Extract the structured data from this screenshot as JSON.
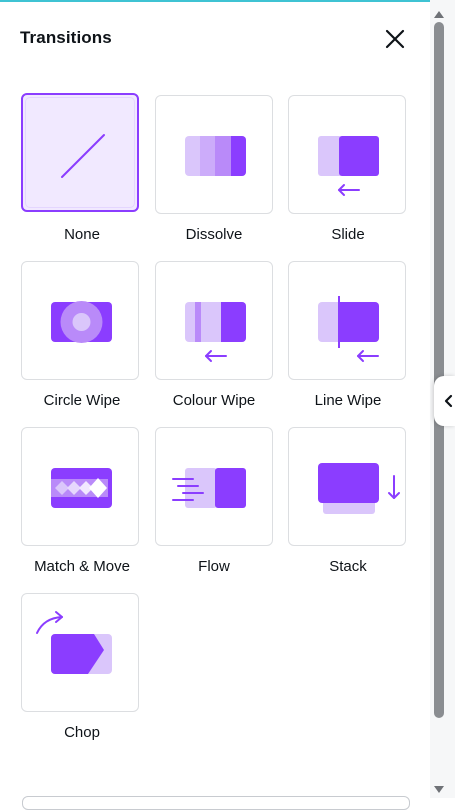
{
  "panel": {
    "title": "Transitions",
    "close_icon": "close-icon"
  },
  "transitions": [
    {
      "label": "None",
      "icon": "none-transition-icon",
      "selected": true
    },
    {
      "label": "Dissolve",
      "icon": "dissolve-transition-icon"
    },
    {
      "label": "Slide",
      "icon": "slide-transition-icon"
    },
    {
      "label": "Circle Wipe",
      "icon": "circle-wipe-transition-icon"
    },
    {
      "label": "Colour Wipe",
      "icon": "colour-wipe-transition-icon"
    },
    {
      "label": "Line Wipe",
      "icon": "line-wipe-transition-icon"
    },
    {
      "label": "Match & Move",
      "icon": "match-and-move-transition-icon"
    },
    {
      "label": "Flow",
      "icon": "flow-transition-icon"
    },
    {
      "label": "Stack",
      "icon": "stack-transition-icon"
    },
    {
      "label": "Chop",
      "icon": "chop-transition-icon"
    }
  ],
  "colors": {
    "accent": "#8b3dff",
    "accent_light": "#dac6fb",
    "accent_mid": "#b98af9",
    "selected_bg": "#f1e9ff"
  }
}
